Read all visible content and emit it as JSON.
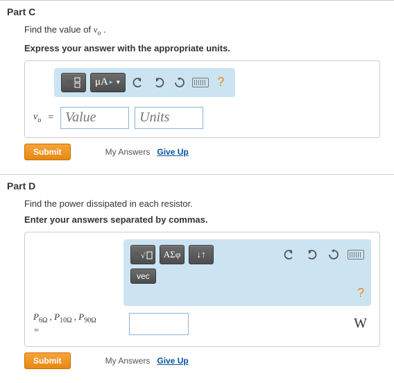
{
  "partC": {
    "title": "Part C",
    "prompt_prefix": "Find the value of ",
    "prompt_var": "v",
    "prompt_sub": "o",
    "prompt_suffix": ".",
    "instruction": "Express your answer with the appropriate units.",
    "unit_button": "μA",
    "help": "?",
    "var": "v",
    "var_sub": "o",
    "eq": "=",
    "value_ph": "Value",
    "units_ph": "Units",
    "submit": "Submit",
    "my_answers": "My Answers",
    "giveup": "Give Up"
  },
  "partD": {
    "title": "Part D",
    "prompt": "Find the power dissipated in each resistor.",
    "instruction": "Enter your answers separated by commas.",
    "greek_btn": "ΑΣφ",
    "sort_btn": "↓↑",
    "vec_btn": "vec",
    "help": "?",
    "label_html": "P<sub>6Ω</sub> , P<sub>10Ω</sub> , P<sub>90Ω</sub> =",
    "label_p": "P",
    "sub1": "6Ω",
    "sub2": "10Ω",
    "sub3": "90Ω",
    "comma": " , ",
    "eq": "=",
    "unit": "W",
    "submit": "Submit",
    "my_answers": "My Answers",
    "giveup": "Give Up"
  }
}
